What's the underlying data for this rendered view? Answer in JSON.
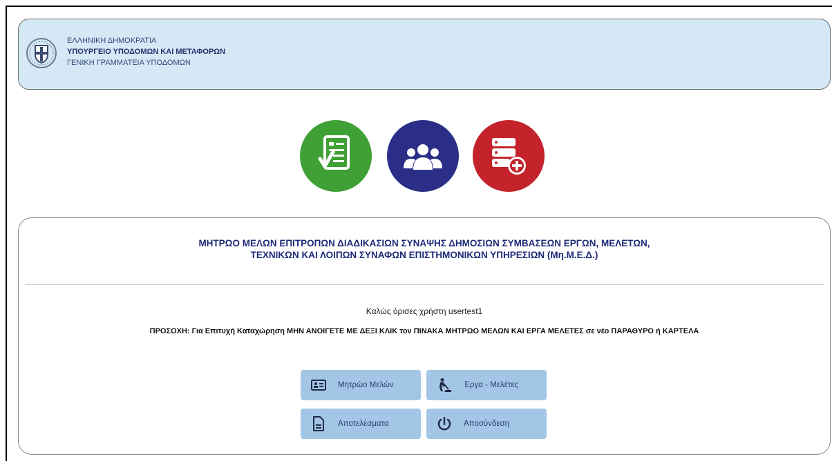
{
  "header": {
    "line1": "ΕΛΛΗΝΙΚΗ ΔΗΜΟΚΡΑΤΙΑ",
    "line2": "ΥΠΟΥΡΓΕΙΟ ΥΠΟΔΟΜΩΝ ΚΑΙ ΜΕΤΑΦΟΡΩΝ",
    "line3": "ΓΕΝΙΚΗ ΓΡΑΜΜΑΤΕΙΑ ΥΠΟΔΟΜΩΝ"
  },
  "shortcuts": [
    {
      "icon": "document-check-icon",
      "color": "#3fa135"
    },
    {
      "icon": "group-icon",
      "color": "#2a2e86"
    },
    {
      "icon": "database-add-icon",
      "color": "#c4232b"
    }
  ],
  "registry": {
    "title_line1": "ΜΗΤΡΩΟ ΜΕΛΩΝ ΕΠΙΤΡΟΠΩΝ ΔΙΑΔΙΚΑΣΙΩΝ ΣΥΝΑΨΗΣ ΔΗΜΟΣΙΩΝ ΣΥΜΒΑΣΕΩΝ ΕΡΓΩΝ, ΜΕΛΕΤΩΝ,",
    "title_line2": "ΤΕΧΝΙΚΩΝ ΚΑΙ ΛΟΙΠΩΝ ΣΥΝΑΦΩΝ ΕΠΙΣΤΗΜΟΝΙΚΩΝ ΥΠΗΡΕΣΙΩΝ (Μη.Μ.Ε.Δ.)",
    "welcome": "Καλώς όρισες χρήστη usertest1",
    "warning": "ΠΡΟΣΟΧΗ: Για Επιτυχή Καταχώρηση ΜΗΝ ΑΝΟΙΓΕΤΕ ΜΕ ΔΕΞΙ ΚΛΙΚ τον ΠΙΝΑΚΑ ΜΗΤΡΩΟ ΜΕΛΩΝ ΚΑΙ ΕΡΓΑ ΜΕΛΕΤΕΣ σε νέο ΠΑΡΑΘΥΡΟ ή ΚΑΡΤΕΛΑ"
  },
  "buttons": {
    "members": "Μητρώο Μελών",
    "projects": "Έργα - Μελέτες",
    "results": "Αποτελέσματα",
    "logout": "Αποσύνδεση"
  },
  "colors": {
    "header_bg": "#d4e8f5",
    "button_bg": "#a3c6e7",
    "title_text": "#1e2a78"
  }
}
